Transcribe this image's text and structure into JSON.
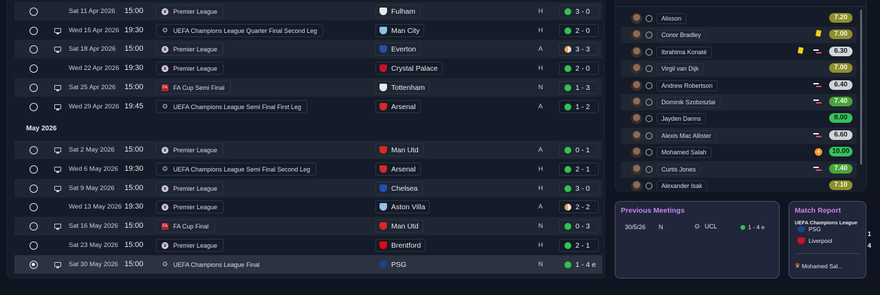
{
  "fixtures": {
    "month_header": "May 2026",
    "rows": [
      {
        "date": "Sat 11 Apr 2026",
        "time": "15:00",
        "tv": false,
        "competition": "Premier League",
        "comp_type": "pl",
        "opponent": "Fulham",
        "crest": "#e8e8e8",
        "venue": "H",
        "result": "3 - 0",
        "outcome": "win",
        "selected": false
      },
      {
        "date": "Wed 15 Apr 2026",
        "time": "19:30",
        "tv": true,
        "competition": "UEFA Champions League Quarter Final Second Leg",
        "comp_type": "ucl",
        "opponent": "Man City",
        "crest": "#8fc1e6",
        "venue": "H",
        "result": "2 - 0",
        "outcome": "win",
        "selected": false
      },
      {
        "date": "Sat 18 Apr 2026",
        "time": "15:00",
        "tv": true,
        "competition": "Premier League",
        "comp_type": "pl",
        "opponent": "Everton",
        "crest": "#2a4fa8",
        "venue": "A",
        "result": "3 - 3",
        "outcome": "draw",
        "selected": false
      },
      {
        "date": "Wed 22 Apr 2026",
        "time": "19:30",
        "tv": false,
        "competition": "Premier League",
        "comp_type": "pl",
        "opponent": "Crystal Palace",
        "crest": "#c8102e",
        "venue": "H",
        "result": "2 - 0",
        "outcome": "win",
        "selected": false
      },
      {
        "date": "Sat 25 Apr 2026",
        "time": "15:00",
        "tv": true,
        "competition": "FA Cup Semi Final",
        "comp_type": "fa",
        "opponent": "Tottenham",
        "crest": "#e8e8e8",
        "venue": "N",
        "result": "1 - 3",
        "outcome": "win",
        "selected": false
      },
      {
        "date": "Wed 29 Apr 2026",
        "time": "19:45",
        "tv": true,
        "competition": "UEFA Champions League Semi Final First Leg",
        "comp_type": "ucl",
        "opponent": "Arsenal",
        "crest": "#d62828",
        "venue": "A",
        "result": "1 - 2",
        "outcome": "win",
        "selected": false
      },
      {
        "date": "Sat 2 May 2026",
        "time": "15:00",
        "tv": true,
        "competition": "Premier League",
        "comp_type": "pl",
        "opponent": "Man Utd",
        "crest": "#da291c",
        "venue": "A",
        "result": "0 - 1",
        "outcome": "win",
        "selected": false
      },
      {
        "date": "Wed 6 May 2026",
        "time": "19:30",
        "tv": true,
        "competition": "UEFA Champions League Semi Final Second Leg",
        "comp_type": "ucl",
        "opponent": "Arsenal",
        "crest": "#d62828",
        "venue": "H",
        "result": "2 - 1",
        "outcome": "win",
        "selected": false
      },
      {
        "date": "Sat 9 May 2026",
        "time": "15:00",
        "tv": true,
        "competition": "Premier League",
        "comp_type": "pl",
        "opponent": "Chelsea",
        "crest": "#1f4fb4",
        "venue": "H",
        "result": "3 - 0",
        "outcome": "win",
        "selected": false
      },
      {
        "date": "Wed 13 May 2026",
        "time": "19:30",
        "tv": false,
        "competition": "Premier League",
        "comp_type": "pl",
        "opponent": "Aston Villa",
        "crest": "#95bfe5",
        "venue": "A",
        "result": "2 - 2",
        "outcome": "draw",
        "selected": false
      },
      {
        "date": "Sat 16 May 2026",
        "time": "15:00",
        "tv": true,
        "competition": "FA Cup Final",
        "comp_type": "fa",
        "opponent": "Man Utd",
        "crest": "#da291c",
        "venue": "N",
        "result": "0 - 3",
        "outcome": "win",
        "selected": false
      },
      {
        "date": "Sat 23 May 2026",
        "time": "15:00",
        "tv": false,
        "competition": "Premier League",
        "comp_type": "pl",
        "opponent": "Brentford",
        "crest": "#e30613",
        "venue": "H",
        "result": "2 - 1",
        "outcome": "win",
        "selected": false
      },
      {
        "date": "Sat 30 May 2026",
        "time": "15:00",
        "tv": true,
        "competition": "UEFA Champions League Final",
        "comp_type": "ucl",
        "opponent": "PSG",
        "crest": "#1d3f8c",
        "venue": "N",
        "result": "1 - 4 e",
        "outcome": "win",
        "selected": true
      }
    ]
  },
  "lineup": {
    "players": [
      {
        "name": "Alisson",
        "rating": "7.20",
        "rating_style": "olive",
        "event": ""
      },
      {
        "name": "Conor Bradley",
        "rating": "7.00",
        "rating_style": "olive",
        "event": "yellow"
      },
      {
        "name": "Ibrahima Konaté",
        "rating": "6.30",
        "rating_style": "grey",
        "event": "yellow-sub"
      },
      {
        "name": "Virgil van Dijk",
        "rating": "7.00",
        "rating_style": "olive",
        "event": ""
      },
      {
        "name": "Andrew Robertson",
        "rating": "6.40",
        "rating_style": "grey",
        "event": "sub"
      },
      {
        "name": "Dominik Szoboszlai",
        "rating": "7.40",
        "rating_style": "lime",
        "event": "sub"
      },
      {
        "name": "Jayden Danns",
        "rating": "8.00",
        "rating_style": "green",
        "event": ""
      },
      {
        "name": "Alexis Mac Allister",
        "rating": "6.60",
        "rating_style": "grey",
        "event": "sub"
      },
      {
        "name": "Mohamed Salah",
        "rating": "10.00",
        "rating_style": "green",
        "event": "goal"
      },
      {
        "name": "Curtis Jones",
        "rating": "7.40",
        "rating_style": "lime",
        "event": "sub"
      },
      {
        "name": "Alexander Isak",
        "rating": "7.10",
        "rating_style": "olive",
        "event": ""
      }
    ]
  },
  "previous_meetings": {
    "title": "Previous Meetings",
    "date": "30/5/26",
    "venue": "N",
    "competition": "UCL",
    "result": "1 - 4 e"
  },
  "match_report": {
    "title": "Match Report",
    "competition": "UEFA Champions League",
    "home_team": "PSG",
    "home_score": "1",
    "away_team": "Liverpool",
    "away_score": "4",
    "player_of_match": "Mohamed Sal..."
  },
  "colors": {
    "accent_title": "#c387e8",
    "win": "#34c14f",
    "draw": "#f0a14a"
  }
}
